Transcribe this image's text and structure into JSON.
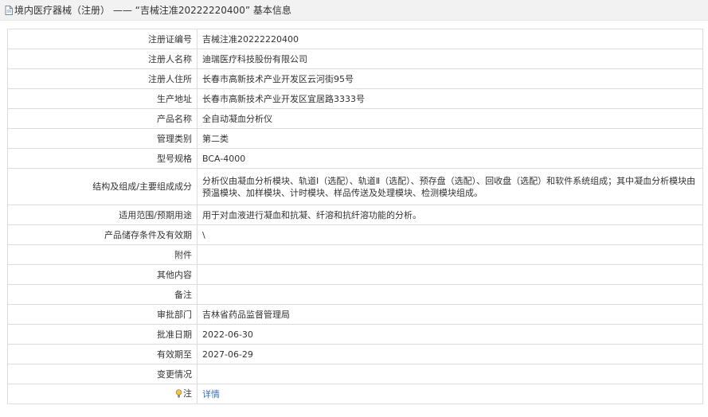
{
  "header": {
    "title": "境内医疗器械（注册） —— “吉械注准20222220400” 基本信息"
  },
  "rows": [
    {
      "label": "注册证编号",
      "value": "吉械注准20222220400"
    },
    {
      "label": "注册人名称",
      "value": "迪瑞医疗科技股份有限公司"
    },
    {
      "label": "注册人住所",
      "value": "长春市高新技术产业开发区云河街95号"
    },
    {
      "label": "生产地址",
      "value": "长春市高新技术产业开发区宜居路3333号"
    },
    {
      "label": "产品名称",
      "value": "全自动凝血分析仪"
    },
    {
      "label": "管理类别",
      "value": "第二类"
    },
    {
      "label": "型号规格",
      "value": "BCA-4000"
    },
    {
      "label": "结构及组成/主要组成成分",
      "value": "分析仪由凝血分析模块、轨道Ⅰ（选配）、轨道Ⅱ（选配）、预存盘（选配）、回收盘（选配）和软件系统组成；其中凝血分析模块由预温模块、加样模块、计时模块、样品传送及处理模块、检测模块组成。"
    },
    {
      "label": "适用范围/预期用途",
      "value": "用于对血液进行凝血和抗凝、纤溶和抗纤溶功能的分析。"
    },
    {
      "label": "产品储存条件及有效期",
      "value": "\\"
    },
    {
      "label": "附件",
      "value": ""
    },
    {
      "label": "其他内容",
      "value": ""
    },
    {
      "label": "备注",
      "value": ""
    },
    {
      "label": "审批部门",
      "value": "吉林省药品监督管理局"
    },
    {
      "label": "批准日期",
      "value": "2022-06-30"
    },
    {
      "label": "有效期至",
      "value": "2027-06-29"
    },
    {
      "label": "变更情况",
      "value": ""
    }
  ],
  "note_row": {
    "label": "注",
    "link": "详情"
  },
  "colors": {
    "header_bg": "#f2f2f2",
    "border": "#dcdcdc",
    "link": "#3a6fb0"
  }
}
